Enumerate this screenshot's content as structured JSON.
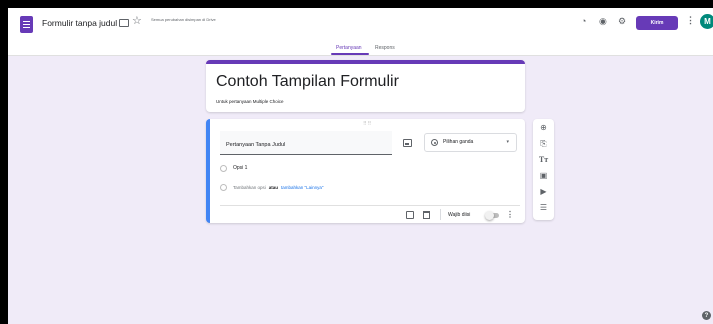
{
  "header": {
    "form_title": "Formulir tanpa judul",
    "save_status": "Semua perubahan disimpan di Drive",
    "send_label": "Kirim",
    "avatar_letter": "M",
    "icons": [
      "palette-icon",
      "eye-icon",
      "gear-icon",
      "more-vert-icon"
    ]
  },
  "tabs": [
    {
      "label": "Pertanyaan",
      "active": true
    },
    {
      "label": "Respons",
      "active": false
    }
  ],
  "form": {
    "title": "Contoh Tampilan Formulir",
    "description": "Untuk pertanyaan Multiple Choice"
  },
  "question": {
    "title": "Pertanyaan Tanpa Judul",
    "type_label": "Pilihan ganda",
    "options": [
      "Opsi 1"
    ],
    "add_option_label": "Tambahkan opsi",
    "or_label": "atau",
    "add_other_label": "tambahkan \"Lainnya\"",
    "required_label": "Wajib diisi",
    "required": false
  },
  "toolbar": {
    "icons": [
      "add-circle-icon",
      "import-icon",
      "title-icon",
      "image-icon",
      "video-icon",
      "section-icon"
    ]
  },
  "colors": {
    "primary": "#673ab7",
    "background": "#f0ebf8",
    "question_accent": "#4285f4",
    "avatar": "#00897b"
  }
}
